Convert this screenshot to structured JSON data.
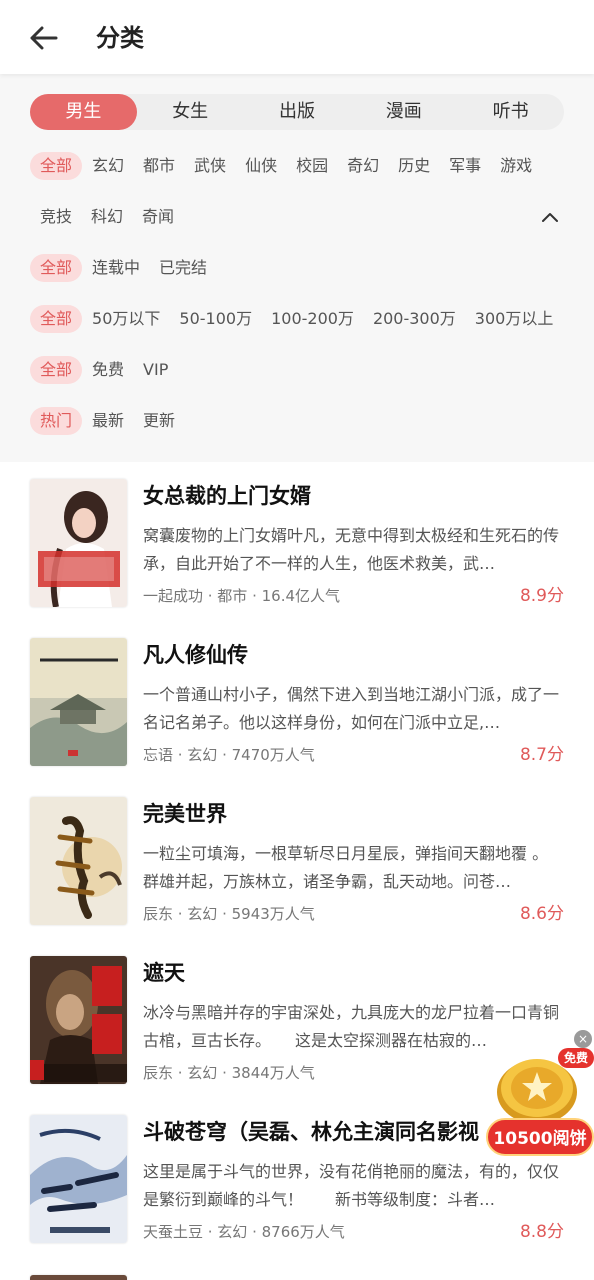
{
  "header": {
    "title": "分类",
    "back_icon": "arrow-left-icon"
  },
  "tabs": [
    {
      "label": "男生",
      "active": true
    },
    {
      "label": "女生",
      "active": false
    },
    {
      "label": "出版",
      "active": false
    },
    {
      "label": "漫画",
      "active": false
    },
    {
      "label": "听书",
      "active": false
    }
  ],
  "filters": {
    "genre_row1": [
      "全部",
      "玄幻",
      "都市",
      "武侠",
      "仙侠",
      "校园",
      "奇幻",
      "历史",
      "军事",
      "游戏"
    ],
    "genre_row2": [
      "竞技",
      "科幻",
      "奇闻"
    ],
    "status": [
      "全部",
      "连载中",
      "已完结"
    ],
    "wordcount": [
      "全部",
      "50万以下",
      "50-100万",
      "100-200万",
      "200-300万",
      "300万以上"
    ],
    "price": [
      "全部",
      "免费",
      "VIP"
    ],
    "sort": [
      "热门",
      "最新",
      "更新"
    ],
    "collapse_icon": "chevron-up-icon"
  },
  "books": [
    {
      "title": "女总裁的上门女婿",
      "desc": "窝囊废物的上门女婿叶凡，无意中得到太极经和生死石的传承，自此开始了不一样的人生，他医术救美，武…",
      "meta": "一起成功 · 都市 · 16.4亿人气",
      "score": "8.9分"
    },
    {
      "title": "凡人修仙传",
      "desc": "一个普通山村小子，偶然下进入到当地江湖小门派，成了一名记名弟子。他以这样身份，如何在门派中立足,…",
      "meta": "忘语 · 玄幻 · 7470万人气",
      "score": "8.7分"
    },
    {
      "title": "完美世界",
      "desc": "一粒尘可填海，一根草斩尽日月星辰，弹指间天翻地覆 。 群雄并起，万族林立，诸圣争霸，乱天动地。问苍…",
      "meta": "辰东 · 玄幻 · 5943万人气",
      "score": "8.6分"
    },
    {
      "title": "遮天",
      "desc": "冰冷与黑暗并存的宇宙深处，九具庞大的龙尸拉着一口青铜古棺，亘古长存。　　这是太空探测器在枯寂的…",
      "meta": "辰东 · 玄幻 · 3844万人气",
      "score": ""
    },
    {
      "title": "斗破苍穹（吴磊、林允主演同名影视",
      "desc": "这里是属于斗气的世界，没有花俏艳丽的魔法，有的，仅仅是繁衍到巅峰的斗气！　　新书等级制度：斗者…",
      "meta": "天蚕土豆 · 玄幻 · 8766万人气",
      "score": "8.8分"
    }
  ],
  "promo": {
    "badge": "免费",
    "amount": "10500阅饼",
    "close": "×"
  }
}
